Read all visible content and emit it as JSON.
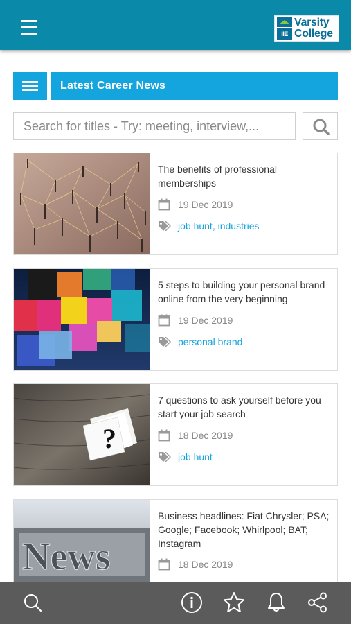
{
  "header": {
    "logo_line1": "Varsity",
    "logo_line2": "College",
    "logo_mark": "IIE"
  },
  "category": {
    "title": "Latest Career News"
  },
  "search": {
    "placeholder": "Search for titles - Try: meeting, interview,..."
  },
  "articles": [
    {
      "title": "The benefits of professional memberships",
      "date": "19 Dec 2019",
      "tags": "job hunt, industries",
      "image": "pins-and-string-network"
    },
    {
      "title": "5 steps to building your personal brand online from the very beginning",
      "date": "19 Dec 2019",
      "tags": "personal brand",
      "image": "colorful-blocks"
    },
    {
      "title": "7 questions to ask yourself before you start your job search",
      "date": "18 Dec 2019",
      "tags": "job hunt",
      "image": "question-mark-cards"
    },
    {
      "title": "Business headlines: Fiat Chrysler; PSA; Google; Facebook; Whirlpool; BAT; Instagram",
      "date": "18 Dec 2019",
      "tags": "",
      "image": "news-letterpress"
    }
  ],
  "bottom_nav": [
    "search-icon",
    "info-icon",
    "star-icon",
    "bell-icon",
    "share-icon"
  ],
  "colors": {
    "header": "#0a8aa8",
    "accent": "#14a4de",
    "bottom_bar": "#5b5b5b"
  }
}
